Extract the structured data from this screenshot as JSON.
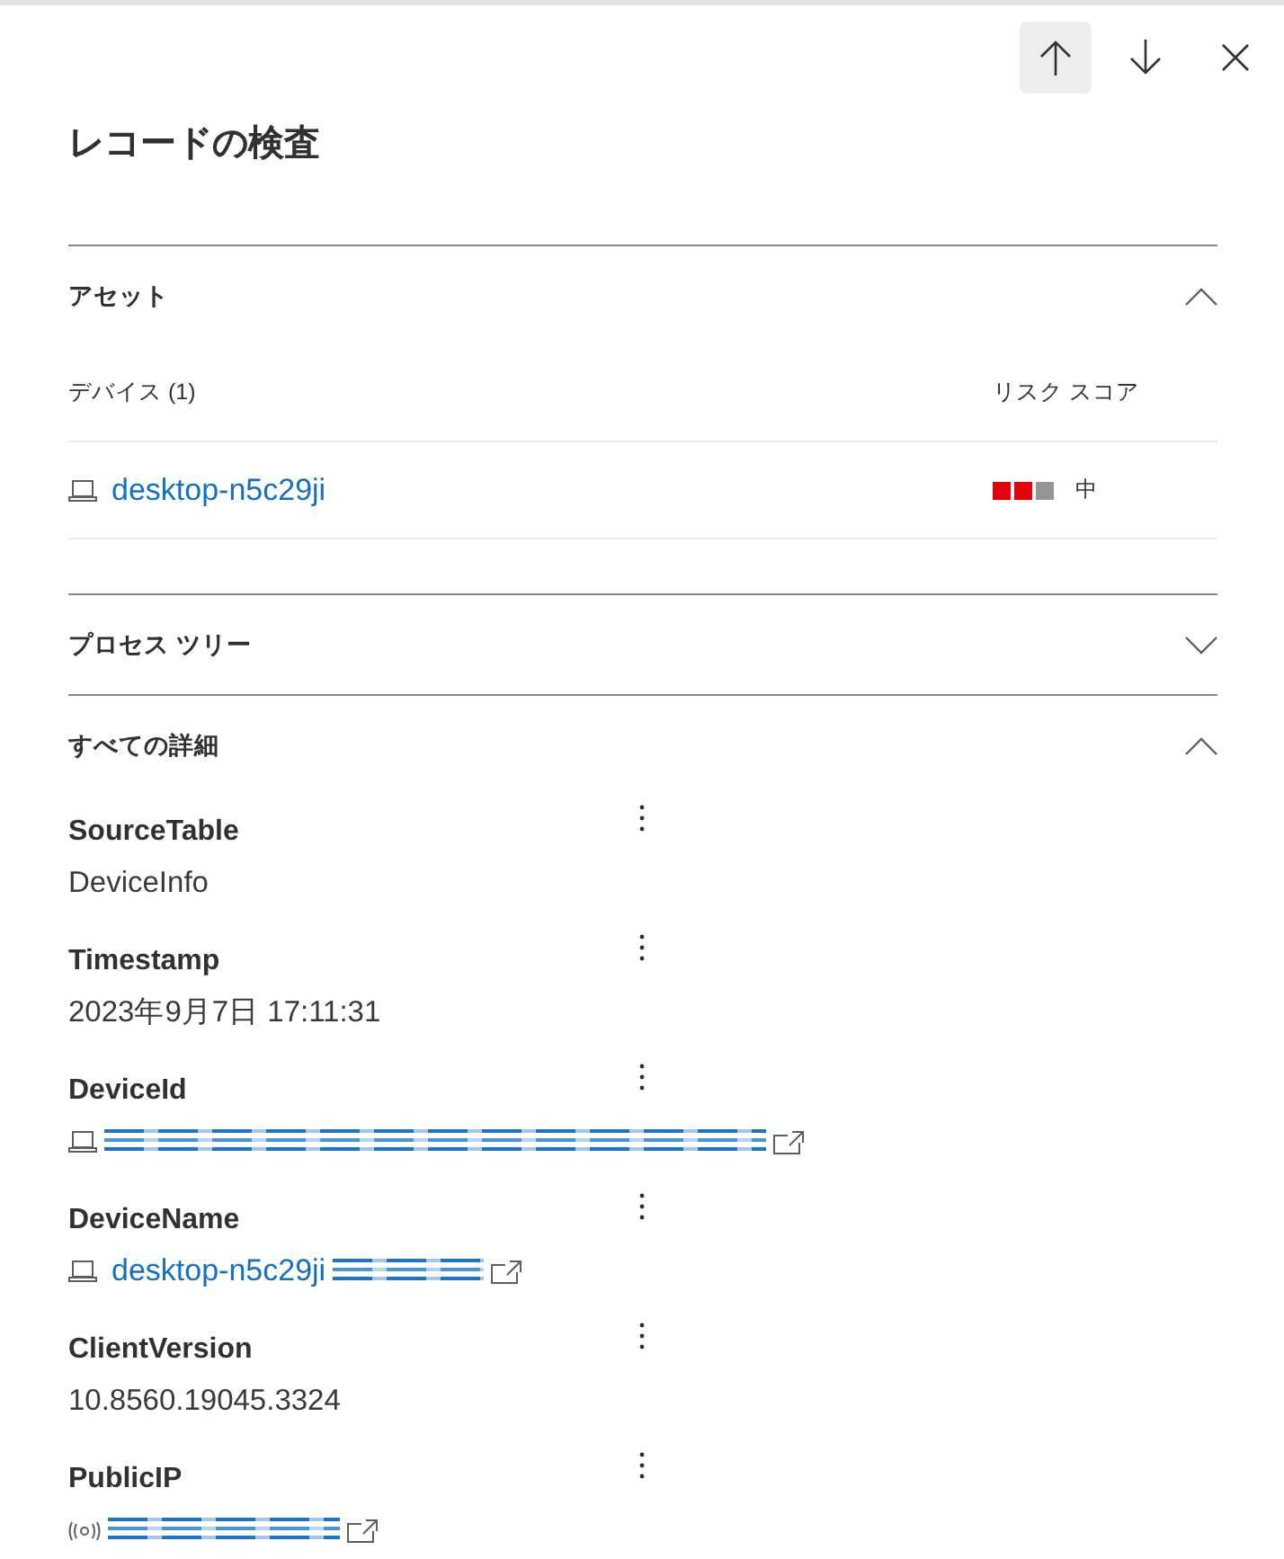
{
  "toolbar": {
    "buttons": [
      {
        "kind": "up",
        "hovered": true
      },
      {
        "kind": "down",
        "hovered": false
      },
      {
        "kind": "close",
        "hovered": false
      }
    ]
  },
  "title": "レコードの検査",
  "sections": [
    {
      "kind": "assets",
      "title": "アセット",
      "expanded": true,
      "table": {
        "columns": [
          "デバイス (1)",
          "リスク スコア"
        ],
        "rows": [
          {
            "device": "desktop-n5c29ji",
            "stars": 2,
            "risk": "中"
          }
        ]
      }
    },
    {
      "title": "プロセス ツリー",
      "expanded": false
    },
    {
      "kind": "details",
      "title": "すべての詳細",
      "expanded": true,
      "fields": [
        {
          "name": "SourceTable",
          "kind": "text",
          "value": "DeviceInfo",
          "redacted": false
        },
        {
          "name": "Timestamp",
          "kind": "text",
          "value": "2023年9月7日 17:11:31",
          "redacted": false
        },
        {
          "name": "DeviceId",
          "kind": "device",
          "redacted": true
        },
        {
          "name": "DeviceName",
          "kind": "device",
          "value": "desktop-n5c29ji",
          "redacted": true
        },
        {
          "name": "ClientVersion",
          "kind": "text",
          "value": "10.8560.19045.3324",
          "redacted": false
        },
        {
          "name": "PublicIP",
          "kind": "ip",
          "redacted": true
        }
      ]
    }
  ]
}
